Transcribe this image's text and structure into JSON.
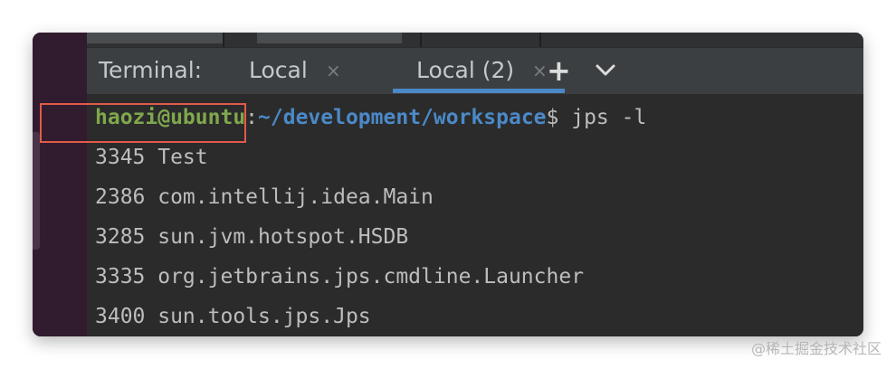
{
  "tabbar": {
    "title": "Terminal:",
    "tabs": [
      {
        "label": "Local",
        "close": "×",
        "active": false
      },
      {
        "label": "Local (2)",
        "close": "×",
        "active": true
      }
    ],
    "add_label": "+"
  },
  "terminal": {
    "prompt": {
      "user": "haozi@ubuntu",
      "separator": ":",
      "path": "~/development/workspace",
      "dollar": "$",
      "command": " jps -l"
    },
    "output": [
      "3345 Test",
      "2386 com.intellij.idea.Main",
      "3285 sun.jvm.hotspot.HSDB",
      "3335 org.jetbrains.jps.cmdline.Launcher",
      "3400 sun.tools.jps.Jps"
    ]
  },
  "watermark": "@稀土掘金技术社区",
  "colors": {
    "accent": "#4a88c7",
    "prompt_user": "#7fa84d",
    "prompt_path": "#4b89c8",
    "highlight": "#e25a4a"
  }
}
